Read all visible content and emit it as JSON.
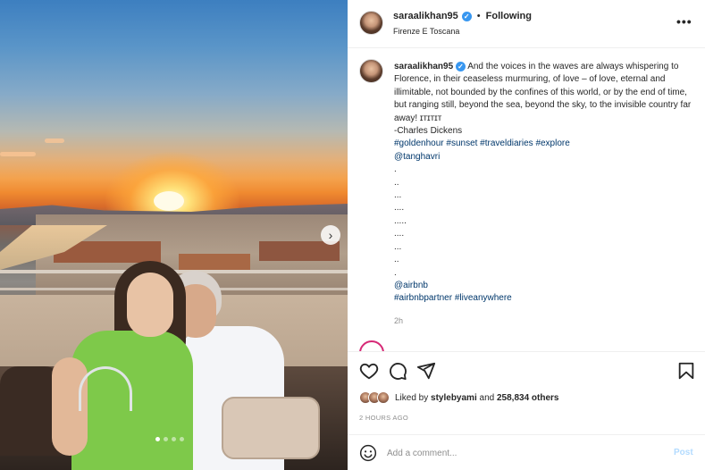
{
  "header": {
    "username": "saraalikhan95",
    "verified_mark": "✓",
    "separator": "•",
    "follow_status": "Following",
    "location": "Firenze E Toscana",
    "more_label": "•••"
  },
  "caption": {
    "username": "saraalikhan95",
    "verified_mark": "✓",
    "body": "And the voices in the waves are always whispering to Florence, in their ceaseless murmuring, of love – of love, eternal and illimitable, not bounded by the confines of this world, or by the end of time, but ranging still, beyond the sea, beyond the sky, to the invisible country far away! ɪᴛɪᴛɪᴛ",
    "attribution": "-Charles Dickens",
    "hashtags": "#goldenhour #sunset #traveldiaries #explore",
    "mention": "@tanghavri",
    "dot_lines": [
      ".",
      "..",
      "...",
      "....",
      ".....",
      "....",
      "...",
      "..",
      "."
    ],
    "mention2": "@airbnb",
    "hashtags2": "#airbnbpartner #liveanywhere",
    "time_ago": "2h"
  },
  "likes": {
    "prefix": "Liked by ",
    "user": "stylebyami",
    "middle": " and ",
    "count": "258,834 others"
  },
  "post_time": "2 HOURS AGO",
  "comment": {
    "placeholder": "Add a comment...",
    "post_label": "Post"
  },
  "carousel": {
    "next_label": "›",
    "dots": 4,
    "active_dot": 0
  },
  "icons": {
    "like": "heart-icon",
    "comment": "comment-icon",
    "share": "share-icon",
    "save": "bookmark-icon",
    "emoji": "emoji-icon"
  }
}
